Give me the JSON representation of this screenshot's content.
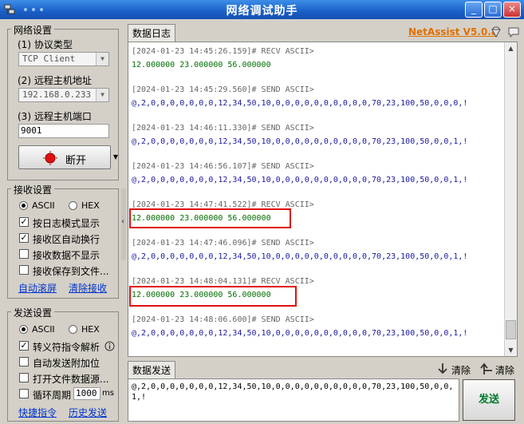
{
  "window": {
    "title": "网络调试助手"
  },
  "net": {
    "group_title": "网络设置",
    "protocol_label": "(1) 协议类型",
    "protocol_value": "TCP Client",
    "host_label": "(2) 远程主机地址",
    "host_value": "192.168.0.233",
    "port_label": "(3) 远程主机端口",
    "port_value": "9001",
    "disconnect_label": "断开"
  },
  "recv": {
    "group_title": "接收设置",
    "ascii": "ASCII",
    "hex": "HEX",
    "opt_log_mode": "按日志模式显示",
    "opt_auto_wrap": "接收区自动换行",
    "opt_hide": "接收数据不显示",
    "opt_save": "接收保存到文件...",
    "link_auto_scroll": "自动滚屏",
    "link_clear": "清除接收"
  },
  "send": {
    "group_title": "发送设置",
    "ascii": "ASCII",
    "hex": "HEX",
    "opt_escape": "转义符指令解析",
    "opt_append_check": "自动发送附加位",
    "opt_open_file": "打开文件数据源...",
    "opt_cycle": "循环周期",
    "cycle_value": "1000",
    "cycle_unit": "ms",
    "link_quick": "快捷指令",
    "link_history": "历史发送"
  },
  "log": {
    "tab_label": "数据日志",
    "brand": "NetAssist V5.0.8",
    "lines": [
      {
        "text": "[2024-01-23 14:45:26.159]# RECV ASCII>",
        "type": "hdr"
      },
      {
        "text": "12.000000 23.000000 56.000000",
        "type": "recv"
      },
      {
        "text": "[2024-01-23 14:45:29.560]# SEND ASCII>",
        "type": "hdr"
      },
      {
        "text": "@,2,0,0,0,0,0,0,0,12,34,50,10,0,0,0,0,0,0,0,0,0,0,70,23,100,50,0,0,0,!",
        "type": "send"
      },
      {
        "text": "[2024-01-23 14:46:11.330]# SEND ASCII>",
        "type": "hdr"
      },
      {
        "text": "@,2,0,0,0,0,0,0,0,12,34,50,10,0,0,0,0,0,0,0,0,0,0,70,23,100,50,0,0,1,!",
        "type": "send"
      },
      {
        "text": "[2024-01-23 14:46:56.107]# SEND ASCII>",
        "type": "hdr"
      },
      {
        "text": "@,2,0,0,0,0,0,0,0,12,34,50,10,0,0,0,0,0,0,0,0,0,0,70,23,100,50,0,0,1,!",
        "type": "send"
      },
      {
        "text": "[2024-01-23 14:47:41.522]# RECV ASCII>",
        "type": "hdr"
      },
      {
        "text": "12.000000 23.000000 56.000000",
        "type": "recv"
      },
      {
        "text": "[2024-01-23 14:47:46.096]# SEND ASCII>",
        "type": "hdr"
      },
      {
        "text": "@,2,0,0,0,0,0,0,0,12,34,50,10,0,0,0,0,0,0,0,0,0,0,70,23,100,50,0,0,1,!",
        "type": "send"
      },
      {
        "text": "[2024-01-23 14:48:04.131]# RECV ASCII>",
        "type": "hdr"
      },
      {
        "text": "12.000000 23.000000 56.000000",
        "type": "recv"
      },
      {
        "text": "[2024-01-23 14:48:06.600]# SEND ASCII>",
        "type": "hdr"
      },
      {
        "text": "@,2,0,0,0,0,0,0,0,12,34,50,10,0,0,0,0,0,0,0,0,0,0,70,23,100,50,0,0,1,!",
        "type": "send"
      }
    ]
  },
  "sendarea": {
    "tab_label": "数据发送",
    "clear1": "清除",
    "clear2": "清除",
    "content": "@,2,0,0,0,0,0,0,0,12,34,50,10,0,0,0,0,0,0,0,0,0,0,70,23,100,50,0,0,1,!",
    "send_button": "发送"
  },
  "icons": {
    "app": "network-icon",
    "connect": "red-light-icon",
    "help": "info-icon",
    "clear": "arrow-down-icon",
    "clear2": "arrow-up-icon"
  }
}
